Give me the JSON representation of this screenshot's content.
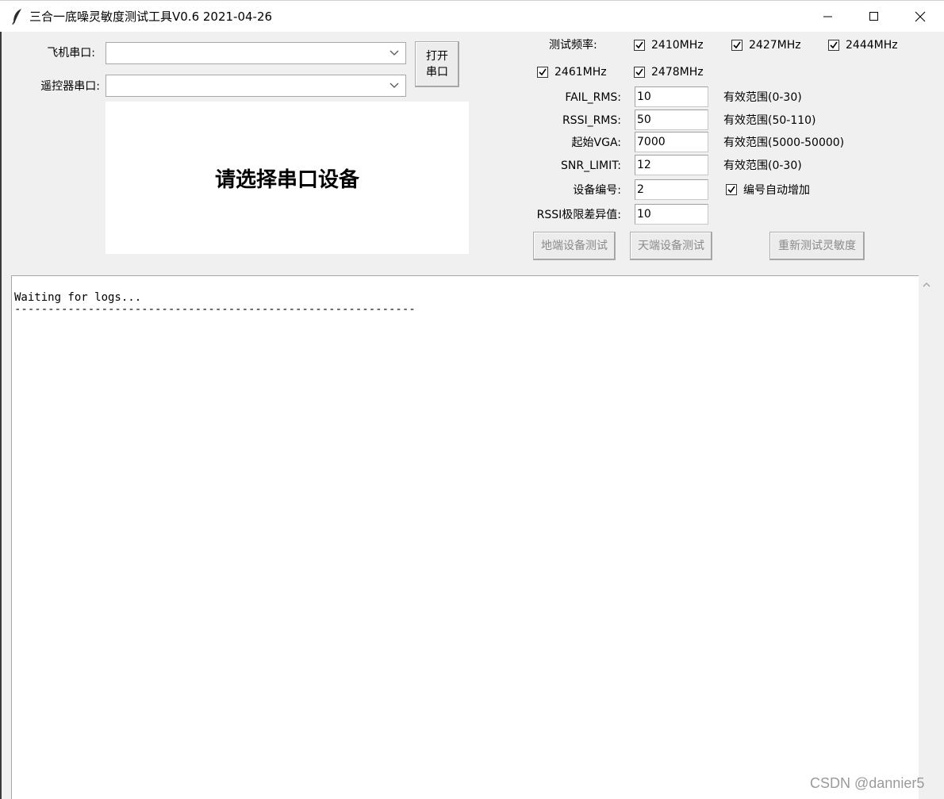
{
  "window": {
    "title": "三合一底噪灵敏度测试工具V0.6 2021-04-26"
  },
  "ports": {
    "aircraft_label": "飞机串口:",
    "aircraft_value": "",
    "remote_label": "遥控器串口:",
    "remote_value": "",
    "open_button": "打开\n串口"
  },
  "status": {
    "message": "请选择串口设备"
  },
  "frequencies": {
    "label": "测试频率:",
    "items": [
      {
        "label": "2410MHz",
        "checked": true
      },
      {
        "label": "2427MHz",
        "checked": true
      },
      {
        "label": "2444MHz",
        "checked": true
      },
      {
        "label": "2461MHz",
        "checked": true
      },
      {
        "label": "2478MHz",
        "checked": true
      }
    ]
  },
  "params": {
    "fail_rms": {
      "label": "FAIL_RMS:",
      "value": "10",
      "hint": "有效范围(0-30)"
    },
    "rssi_rms": {
      "label": "RSSI_RMS:",
      "value": "50",
      "hint": "有效范围(50-110)"
    },
    "start_vga": {
      "label": "起始VGA:",
      "value": "7000",
      "hint": "有效范围(5000-50000)"
    },
    "snr_limit": {
      "label": "SNR_LIMIT:",
      "value": "12",
      "hint": "有效范围(0-30)"
    },
    "device_no": {
      "label": "设备编号:",
      "value": "2",
      "auto_inc_label": "编号自动增加",
      "auto_inc_checked": true
    },
    "rssi_diff": {
      "label": "RSSI极限差异值:",
      "value": "10"
    }
  },
  "actions": {
    "ground_test": "地端设备测试",
    "air_test": "天端设备测试",
    "retest": "重新测试灵敏度"
  },
  "log": {
    "text": "Waiting for logs...\n------------------------------------------------------------"
  },
  "watermark": "CSDN @dannier5"
}
